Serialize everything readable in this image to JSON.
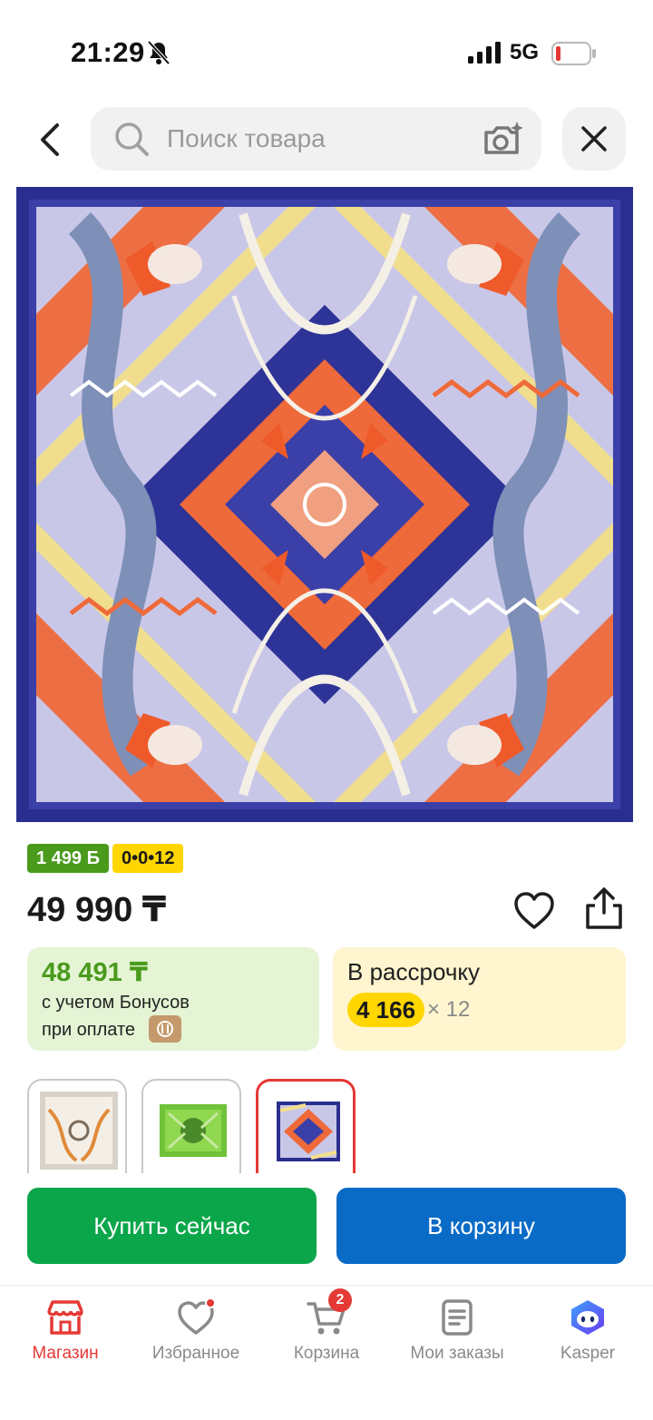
{
  "status_bar": {
    "time": "21:29",
    "network": "5G",
    "battery_color": "#e53935"
  },
  "search": {
    "placeholder": "Поиск товара"
  },
  "product": {
    "bonus_badge": "1 499 Б",
    "installment_badge": "0•0•12",
    "price": "49 990 ₸"
  },
  "bonus_card": {
    "price": "48 491 ₸",
    "line1": "с учетом Бонусов",
    "line2": "при оплате"
  },
  "installment_card": {
    "title": "В рассрочку",
    "amount": "4 166",
    "times": "× 12"
  },
  "actions": {
    "buy_label": "Купить сейчас",
    "cart_label": "В корзину"
  },
  "nav": {
    "items": [
      {
        "label": "Магазин",
        "icon": "shop-icon"
      },
      {
        "label": "Избранное",
        "icon": "heart-icon"
      },
      {
        "label": "Корзина",
        "icon": "cart-icon"
      },
      {
        "label": "Мои заказы",
        "icon": "orders-icon"
      },
      {
        "label": "Kasper",
        "icon": "kasper-icon"
      }
    ],
    "cart_count": "2",
    "accent_color": "#e53935"
  },
  "colors": {
    "buy_green": "#0ba64a",
    "cart_blue": "#0a6bc7",
    "bonus_green": "#4a9a1c",
    "installment_yellow": "#ffd600"
  }
}
